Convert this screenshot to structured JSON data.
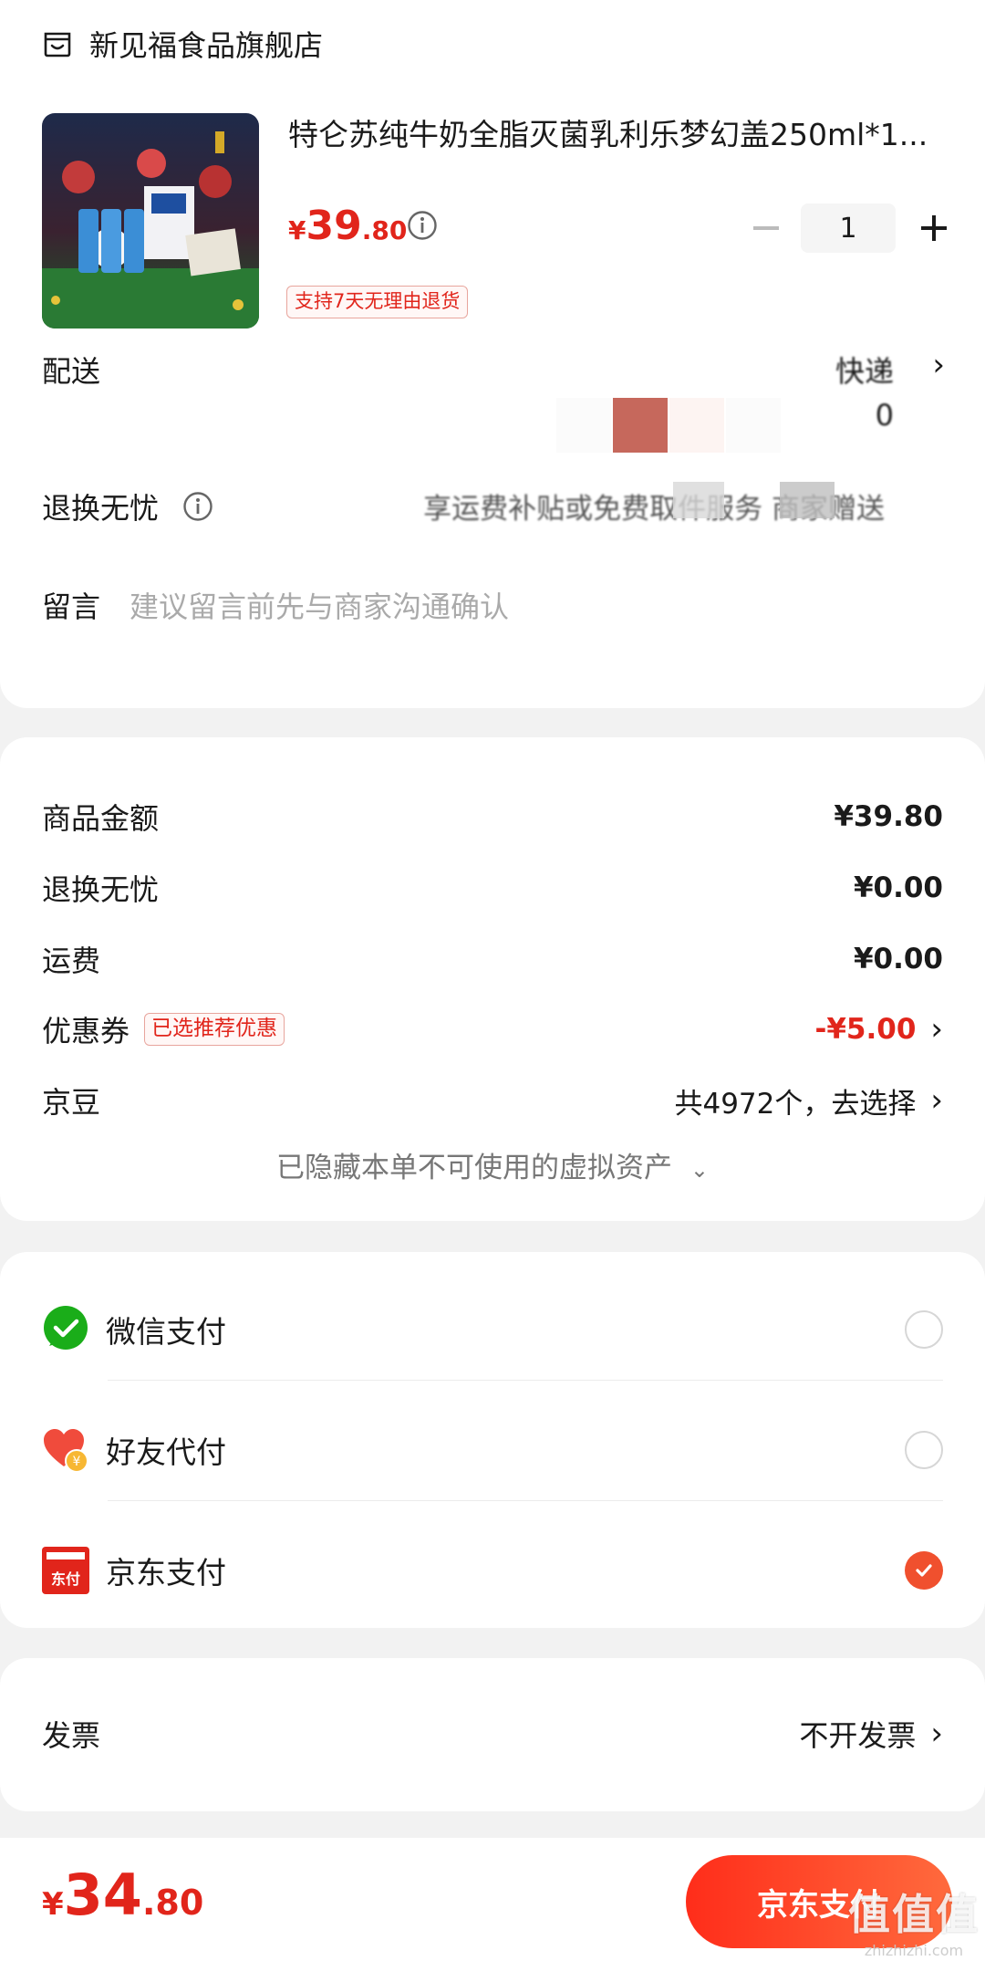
{
  "store": {
    "name": "新见福食品旗舰店",
    "icon": "store-icon"
  },
  "product": {
    "title": "特仑苏纯牛奶全脂灭菌乳利乐梦幻盖250ml*1...",
    "price_currency": "¥",
    "price_int": "39",
    "price_dec": ".80",
    "quantity": "1",
    "return_badge": "支持7天无理由退货"
  },
  "delivery": {
    "label": "配送",
    "value_line1": "快递",
    "value_line2": "0"
  },
  "worry_free": {
    "label": "退换无忧",
    "value": "享运费补贴或免费取件服务 商家赠送"
  },
  "message": {
    "label": "留言",
    "placeholder": "建议留言前先与商家沟通确认"
  },
  "price_detail": {
    "items": [
      {
        "label": "商品金额",
        "value": "¥39.80"
      },
      {
        "label": "退换无忧",
        "value": "¥0.00"
      },
      {
        "label": "运费",
        "value": "¥0.00"
      }
    ],
    "coupon": {
      "label": "优惠券",
      "tag": "已选推荐优惠",
      "value": "-¥5.00"
    },
    "jingdou": {
      "label": "京豆",
      "value": "共4972个，去选择"
    },
    "hidden_assets": "已隐藏本单不可使用的虚拟资产"
  },
  "payment": {
    "options": [
      {
        "label": "微信支付",
        "icon": "wechat-pay-icon",
        "selected": false
      },
      {
        "label": "好友代付",
        "icon": "friend-pay-icon",
        "selected": false
      },
      {
        "label": "京东支付",
        "icon": "jd-pay-icon",
        "selected": true
      }
    ],
    "jd_icon_text": "东付"
  },
  "invoice": {
    "label": "发票",
    "value": "不开发票"
  },
  "footer": {
    "total_currency": "¥",
    "total_int": "34",
    "total_dec": ".80",
    "pay_button": "京东支付",
    "watermark_main": "值值值",
    "watermark_sub": "zhizhizhi.com"
  },
  "colors": {
    "accent": "#e1251b",
    "button_gradient_start": "#ff2d1a",
    "button_gradient_end": "#ff6a3d",
    "background": "#f2f2f2"
  }
}
